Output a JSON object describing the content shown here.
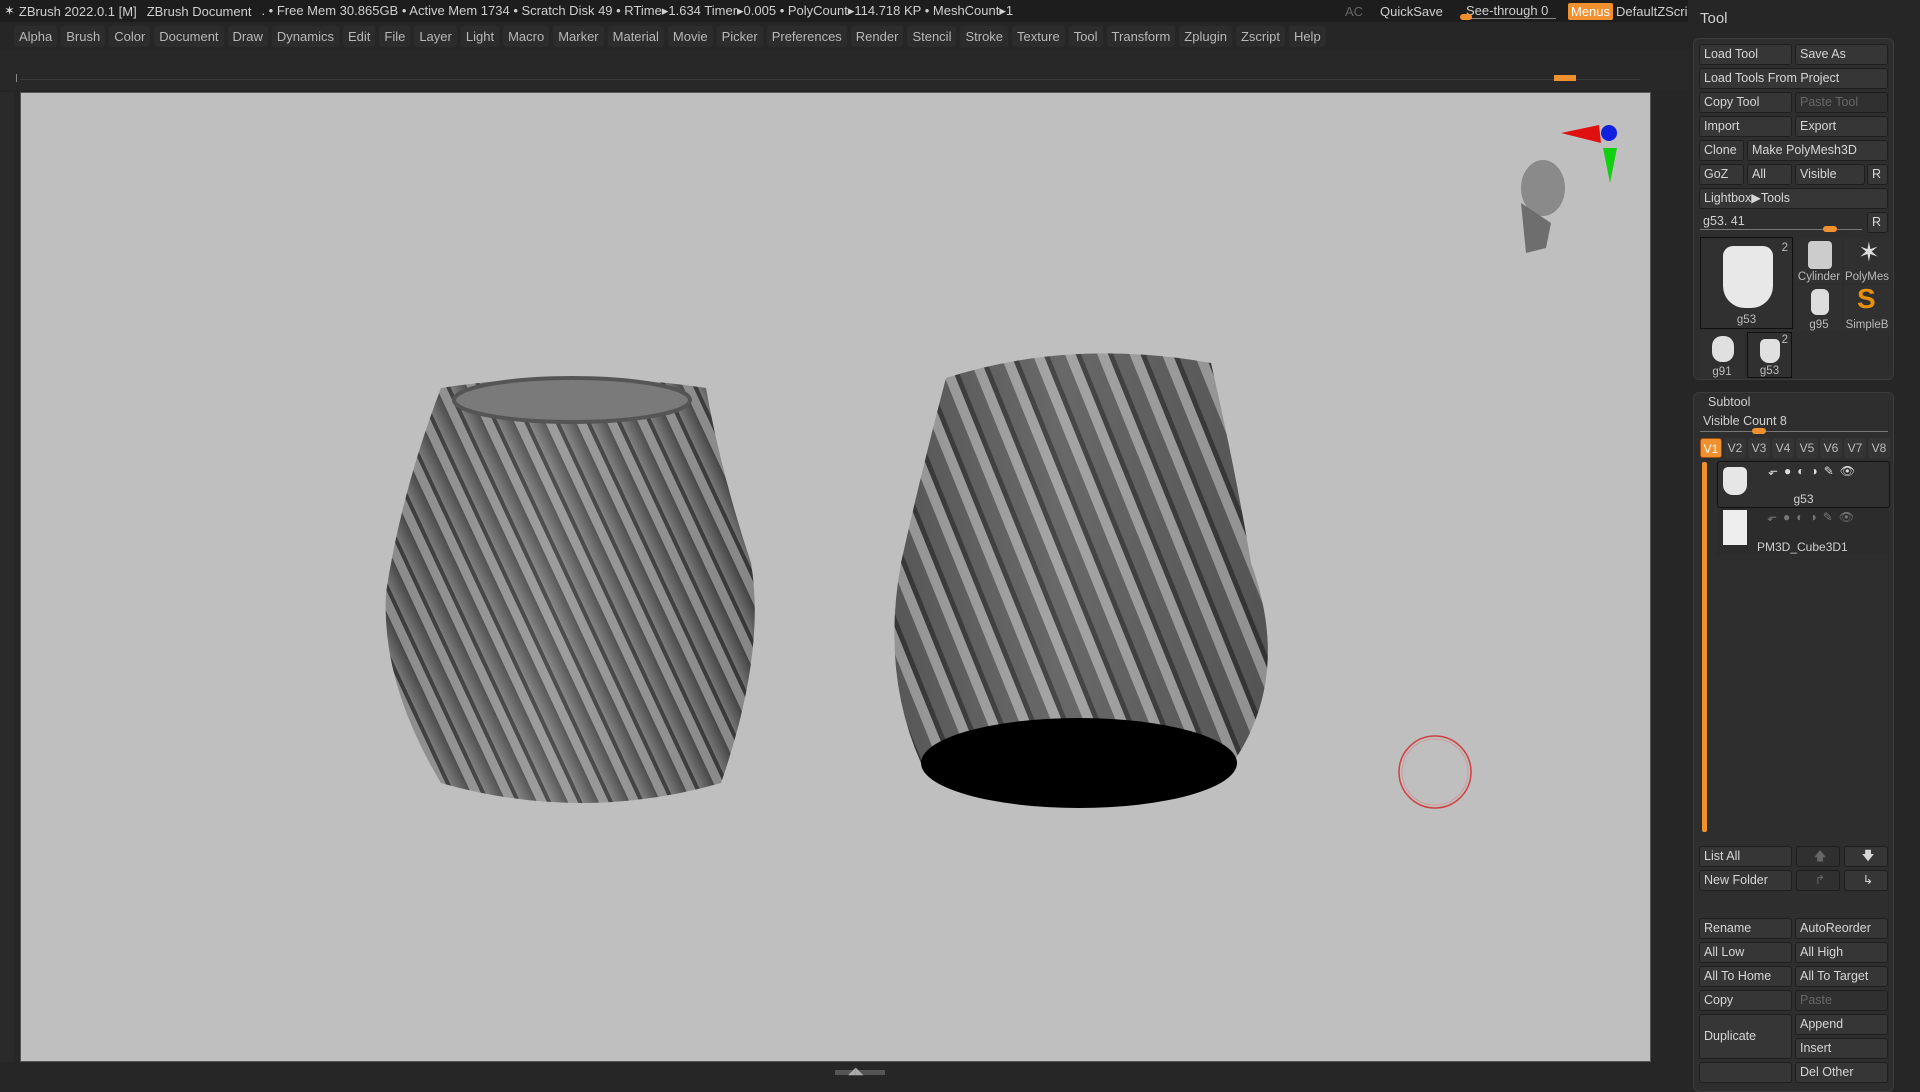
{
  "topbar": {
    "app": "ZBrush 2022.0.1 [M]",
    "doc": "ZBrush Document",
    "stats": ". • Free Mem 30.865GB • Active Mem 1734 • Scratch Disk 49 • RTime▸1.634 Timer▸0.005 • PolyCount▸114.718 KP • MeshCount▸1",
    "ac": "AC",
    "quicksave": "QuickSave",
    "seethrough": "See-through  0",
    "seethrough_value": 0,
    "menus": "Menus",
    "script": "DefaultZScript"
  },
  "menus": [
    "Alpha",
    "Brush",
    "Color",
    "Document",
    "Draw",
    "Dynamics",
    "Edit",
    "File",
    "Layer",
    "Light",
    "Macro",
    "Marker",
    "Material",
    "Movie",
    "Picker",
    "Preferences",
    "Render",
    "Stencil",
    "Stroke",
    "Texture",
    "Tool",
    "Transform",
    "Zplugin",
    "Zscript",
    "Help"
  ],
  "tool": {
    "title": "Tool",
    "load_tool": "Load Tool",
    "save_as": "Save As",
    "load_from_project": "Load Tools From Project",
    "copy_tool": "Copy Tool",
    "paste_tool": "Paste Tool",
    "import": "Import",
    "export": "Export",
    "clone": "Clone",
    "make_polymesh": "Make PolyMesh3D",
    "goz": "GoZ",
    "all": "All",
    "visible": "Visible",
    "r": "R",
    "lightbox": "Lightbox▶Tools",
    "current": "g53. 41",
    "thumbs": [
      {
        "name": "g53",
        "count": "2"
      },
      {
        "name": "Cylinder"
      },
      {
        "name": "PolyMes"
      },
      {
        "name": "g95"
      },
      {
        "name": "SimpleB"
      },
      {
        "name": "g91"
      },
      {
        "name": "g53",
        "count": "2"
      }
    ]
  },
  "subtool": {
    "title": "Subtool",
    "visible_count": "Visible Count 8",
    "visible_count_value": 8,
    "versions": [
      "V1",
      "V2",
      "V3",
      "V4",
      "V5",
      "V6",
      "V7",
      "V8"
    ],
    "active_version": "V1",
    "items": [
      {
        "name": "g53",
        "selected": true
      },
      {
        "name": "PM3D_Cube3D1",
        "selected": false
      }
    ],
    "list_all": "List All",
    "new_folder": "New Folder",
    "rename": "Rename",
    "autoreorder": "AutoReorder",
    "all_low": "All Low",
    "all_high": "All High",
    "all_to_home": "All To Home",
    "all_to_target": "All To Target",
    "copy": "Copy",
    "paste": "Paste",
    "duplicate": "Duplicate",
    "append": "Append",
    "insert": "Insert",
    "del_other": "Del Other"
  },
  "colors": {
    "accent": "#f0902e",
    "viewport": "#bfbfbf",
    "panel": "#2e2e2e"
  }
}
